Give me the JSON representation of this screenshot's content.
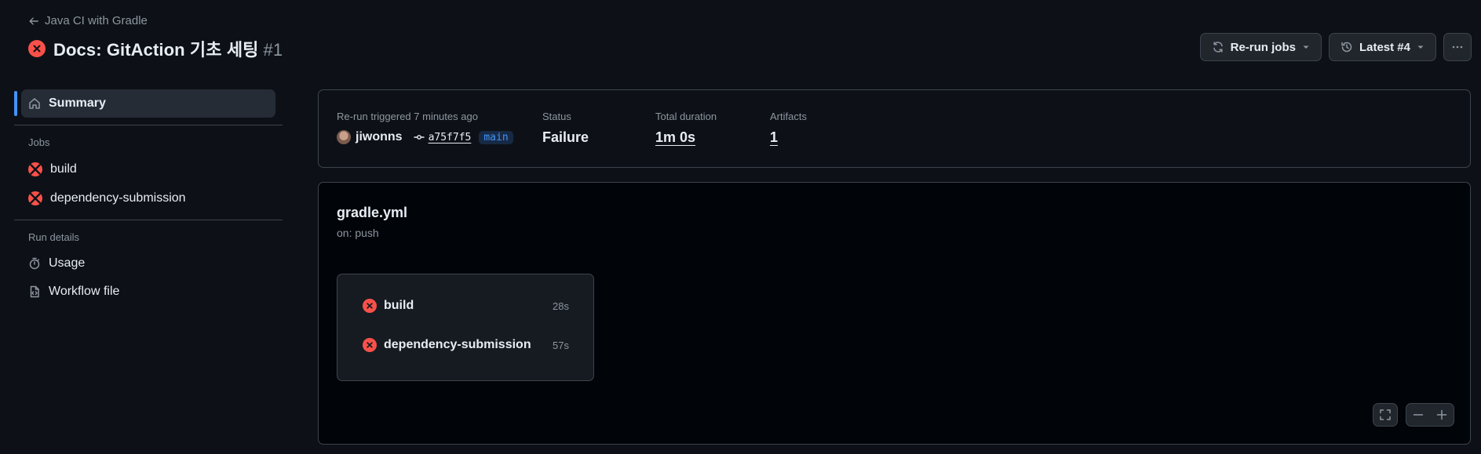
{
  "header": {
    "back_label": "Java CI with Gradle",
    "title": "Docs: GitAction 기초 세팅",
    "run_number": "#1",
    "rerun_label": "Re-run jobs",
    "latest_label": "Latest #4"
  },
  "sidebar": {
    "summary_label": "Summary",
    "jobs_heading": "Jobs",
    "jobs": [
      {
        "label": "build",
        "status": "failure"
      },
      {
        "label": "dependency-submission",
        "status": "failure"
      }
    ],
    "run_details_heading": "Run details",
    "usage_label": "Usage",
    "workflow_file_label": "Workflow file"
  },
  "summary": {
    "trigger_label": "Re-run triggered 7 minutes ago",
    "user": "jiwonns",
    "commit": "a75f7f5",
    "branch": "main",
    "status_label": "Status",
    "status_value": "Failure",
    "duration_label": "Total duration",
    "duration_value": "1m 0s",
    "artifacts_label": "Artifacts",
    "artifacts_value": "1"
  },
  "graph": {
    "workflow_name": "gradle.yml",
    "trigger": "on: push",
    "jobs": [
      {
        "label": "build",
        "duration": "28s",
        "status": "failure"
      },
      {
        "label": "dependency-submission",
        "duration": "57s",
        "status": "failure"
      }
    ]
  },
  "icons": {
    "failure": "x-circle-fill-icon",
    "rerun": "sync-icon",
    "latest": "history-icon",
    "more": "kebab-horizontal-icon",
    "summary": "home-icon",
    "usage": "stopwatch-icon",
    "workflow_file": "file-code-icon",
    "fullscreen": "screen-full-icon",
    "zoom_out": "dash-icon",
    "zoom_in": "plus-icon"
  },
  "colors": {
    "background": "#0d1117",
    "panel": "#010409",
    "failure": "#f85149",
    "accent": "#4493f8",
    "muted_text": "#8d96a0",
    "border": "#3d444d"
  }
}
